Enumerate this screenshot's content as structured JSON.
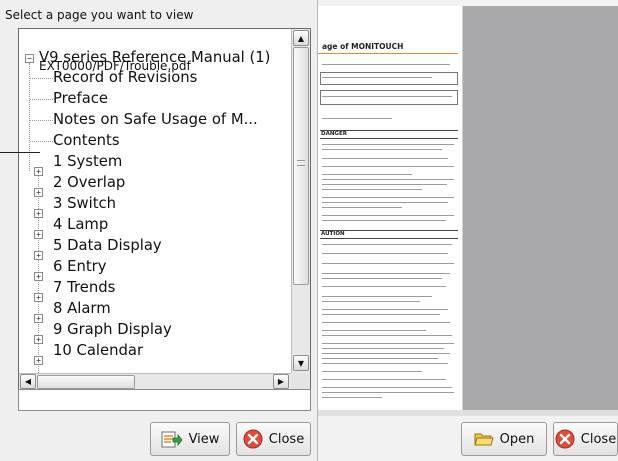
{
  "dialog": {
    "prompt": "Select a page you want to view",
    "path": "EXT0000/PDF/Trouble.pdf",
    "view_label": "View",
    "close_label": "Close"
  },
  "tree": {
    "root": {
      "label": "V9 series Reference Manual (1)",
      "expanded": true
    },
    "leaves": [
      {
        "label": "Record of Revisions"
      },
      {
        "label": "Preface"
      },
      {
        "label": "Notes on Safe Usage of M..."
      },
      {
        "label": "Contents"
      }
    ],
    "chapters": [
      {
        "label": "1 System"
      },
      {
        "label": "2 Overlap"
      },
      {
        "label": "3 Switch"
      },
      {
        "label": "4 Lamp"
      },
      {
        "label": "5 Data Display"
      },
      {
        "label": "6 Entry"
      },
      {
        "label": "7 Trends"
      },
      {
        "label": "8 Alarm"
      },
      {
        "label": "9 Graph Display"
      },
      {
        "label": "10 Calendar"
      }
    ]
  },
  "preview": {
    "title": "age of MONITOUCH",
    "section_danger": "DANGER",
    "section_caution": "AUTION"
  },
  "buttons": {
    "open_label": "Open",
    "close_label": "Close"
  },
  "colors": {
    "dialog_bg": "#efefef",
    "preview_gray": "#a9a9ac",
    "accent_orange": "#e28a2b",
    "close_icon_red": "#e44a3a"
  }
}
